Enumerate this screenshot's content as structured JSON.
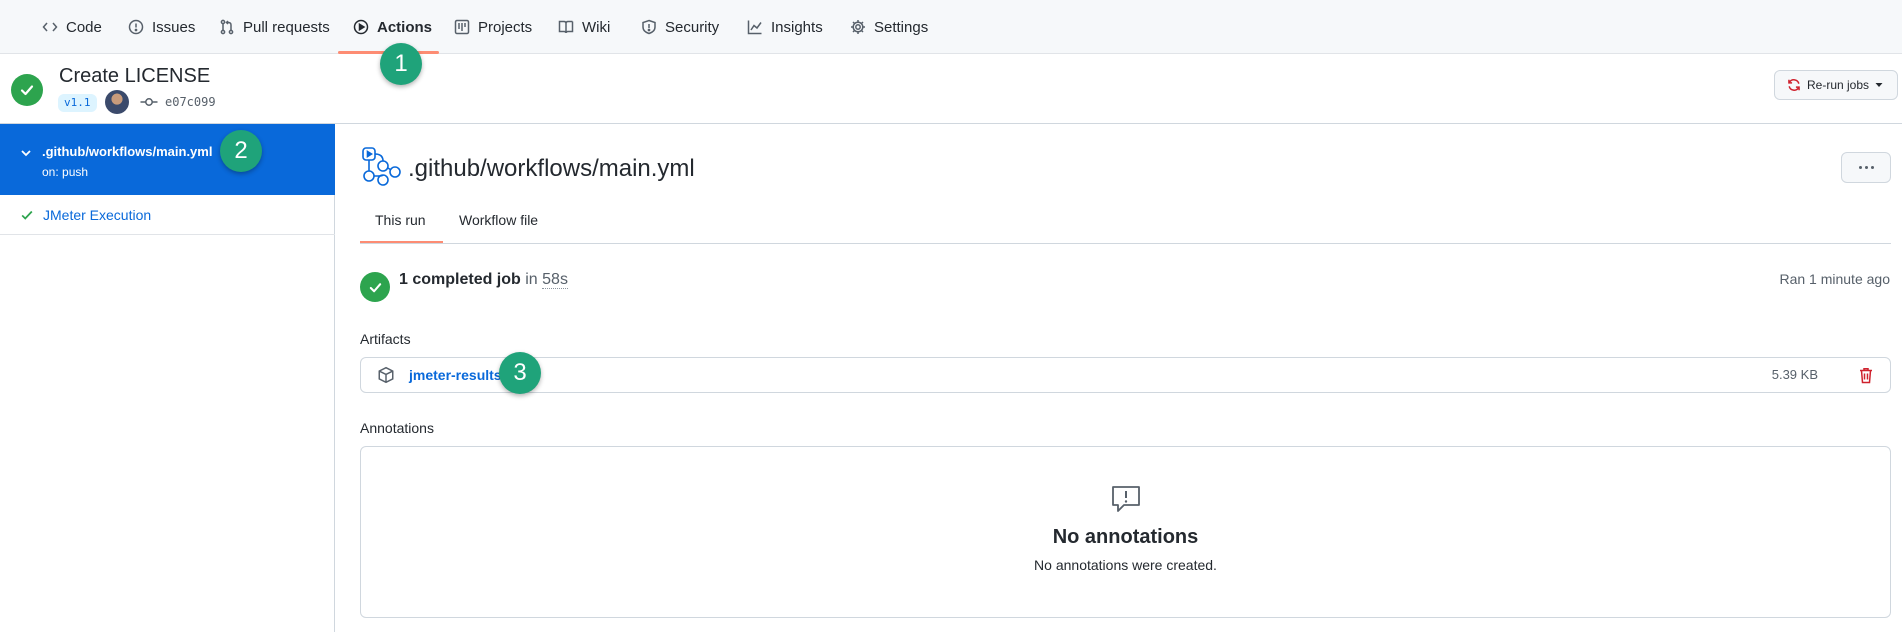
{
  "nav": {
    "tabs": [
      {
        "label": "Code",
        "icon": "code-icon"
      },
      {
        "label": "Issues",
        "icon": "issue-opened-icon"
      },
      {
        "label": "Pull requests",
        "icon": "git-pull-request-icon"
      },
      {
        "label": "Actions",
        "icon": "play-icon",
        "active": true
      },
      {
        "label": "Projects",
        "icon": "project-icon"
      },
      {
        "label": "Wiki",
        "icon": "book-icon"
      },
      {
        "label": "Security",
        "icon": "shield-icon"
      },
      {
        "label": "Insights",
        "icon": "graph-icon"
      },
      {
        "label": "Settings",
        "icon": "gear-icon"
      }
    ]
  },
  "run": {
    "title": "Create LICENSE",
    "tag": "v1.1",
    "commit_sha": "e07c099",
    "rerun_label": "Re-run jobs"
  },
  "sidebar": {
    "workflow_name": ".github/workflows/main.yml",
    "workflow_trigger": "on: push",
    "jobs": [
      {
        "label": "JMeter Execution",
        "status": "success"
      }
    ]
  },
  "main": {
    "workflow_title": ".github/workflows/main.yml",
    "tabs": [
      {
        "label": "This run",
        "active": true
      },
      {
        "label": "Workflow file"
      }
    ],
    "summary": {
      "count_text": "1 completed job",
      "in_text": "in",
      "duration": "58s",
      "ran": "Ran 1 minute ago"
    },
    "artifacts_label": "Artifacts",
    "artifacts": [
      {
        "name": "jmeter-results",
        "size": "5.39 KB"
      }
    ],
    "annotations_label": "Annotations",
    "annotations_empty_title": "No annotations",
    "annotations_empty_text": "No annotations were created."
  },
  "callouts": [
    "1",
    "2",
    "3"
  ],
  "colors": {
    "accent": "#0969da",
    "success": "#2da44e",
    "danger": "#cf222e",
    "callout": "#1fa37a",
    "tab_underline": "#fd8c73"
  }
}
